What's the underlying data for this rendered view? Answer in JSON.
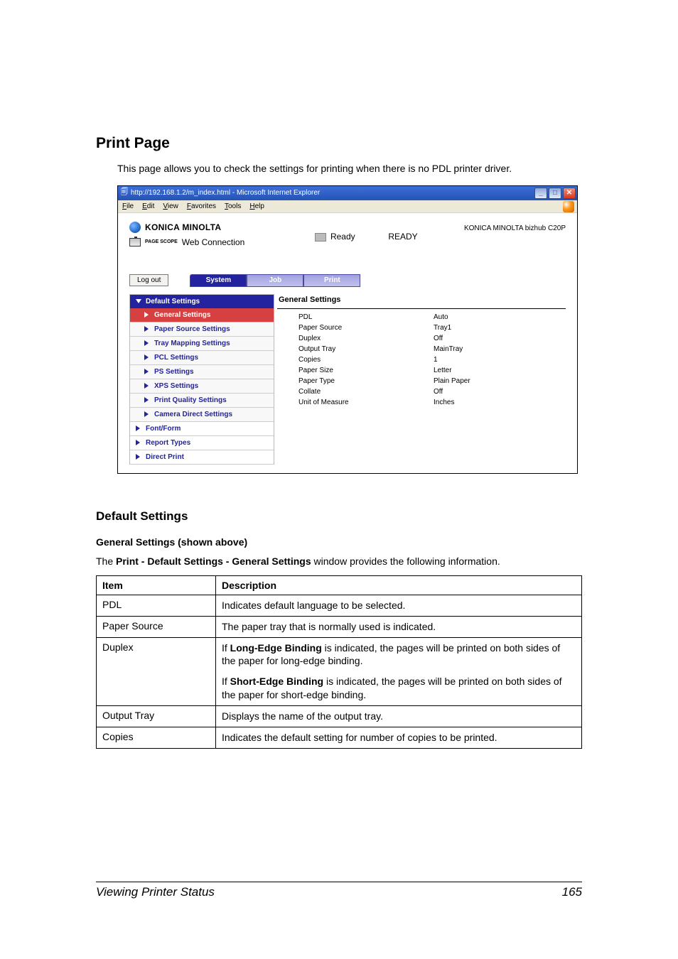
{
  "page_title": "Print Page",
  "intro": "This page allows you to check the settings for printing when there is no PDL printer driver.",
  "browser": {
    "window_title": "http://192.168.1.2/m_index.html - Microsoft Internet Explorer",
    "menu": [
      "File",
      "Edit",
      "View",
      "Favorites",
      "Tools",
      "Help"
    ],
    "brand": "KONICA MINOLTA",
    "sub_brand_prefix": "PAGE SCOPE",
    "sub_brand": "Web Connection",
    "ready_label": "Ready",
    "ready_display": "READY",
    "device": "KONICA MINOLTA bizhub C20P",
    "logout_label": "Log out",
    "tabs": [
      "System",
      "Job",
      "Print"
    ],
    "nav": {
      "header": "Default Settings",
      "subs": [
        "General Settings",
        "Paper Source Settings",
        "Tray Mapping Settings",
        "PCL Settings",
        "PS Settings",
        "XPS Settings",
        "Print Quality Settings",
        "Camera Direct Settings"
      ],
      "roots": [
        "Font/Form",
        "Report Types",
        "Direct Print"
      ]
    },
    "panel": {
      "title": "General Settings",
      "rows": [
        {
          "k": "PDL",
          "v": "Auto"
        },
        {
          "k": "Paper Source",
          "v": "Tray1"
        },
        {
          "k": "Duplex",
          "v": "Off"
        },
        {
          "k": "Output Tray",
          "v": "MainTray"
        },
        {
          "k": "Copies",
          "v": "1"
        },
        {
          "k": "Paper Size",
          "v": "Letter"
        },
        {
          "k": "Paper Type",
          "v": "Plain Paper"
        },
        {
          "k": "Collate",
          "v": "Off"
        },
        {
          "k": "Unit of Measure",
          "v": "Inches"
        }
      ]
    }
  },
  "section": {
    "h2": "Default Settings",
    "h3": "General Settings (shown above)",
    "para_pre": "The ",
    "para_bold": "Print - Default Settings - General Settings",
    "para_post": " window provides the following information.",
    "table": {
      "headers": [
        "Item",
        "Description"
      ],
      "rows": [
        {
          "item": "PDL",
          "desc": [
            "Indicates default language to be selected."
          ]
        },
        {
          "item": "Paper Source",
          "desc": [
            "The paper tray that is normally used is indicated."
          ]
        },
        {
          "item": "Duplex",
          "desc": [
            {
              "pre": "If ",
              "bold": "Long-Edge Binding",
              "post": " is indicated, the pages will be printed on both sides of the paper for long-edge binding."
            },
            {
              "pre": "If ",
              "bold": "Short-Edge Binding",
              "post": " is indicated, the pages will be printed on both sides of the paper for short-edge binding."
            }
          ]
        },
        {
          "item": "Output Tray",
          "desc": [
            "Displays the name of the output tray."
          ]
        },
        {
          "item": "Copies",
          "desc": [
            "Indicates the default setting for number of copies to be printed."
          ]
        }
      ]
    }
  },
  "footer": {
    "left": "Viewing Printer Status",
    "right": "165"
  }
}
